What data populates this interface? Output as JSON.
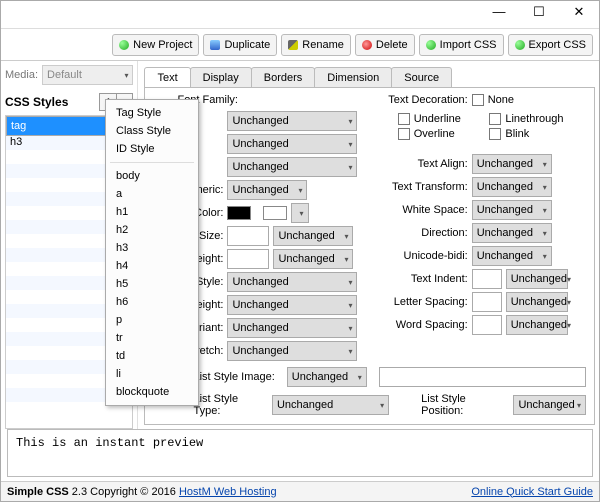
{
  "titlebar": {
    "min": "—",
    "max": "☐",
    "close": "✕"
  },
  "toolbar": {
    "new_project": "New Project",
    "duplicate": "Duplicate",
    "rename": "Rename",
    "delete": "Delete",
    "import_css": "Import CSS",
    "export_css": "Export CSS"
  },
  "media": {
    "label": "Media:",
    "value": "Default"
  },
  "css_styles_head": "CSS Styles",
  "plus": "+",
  "minus": "−",
  "styles": [
    "tag",
    "h3"
  ],
  "popup": {
    "tag": "Tag Style",
    "cls": "Class Style",
    "id": "ID Style",
    "tags": [
      "body",
      "a",
      "h1",
      "h2",
      "h3",
      "h4",
      "h5",
      "h6",
      "p",
      "tr",
      "td",
      "li",
      "blockquote"
    ]
  },
  "tabs": [
    "Text",
    "Display",
    "Borders",
    "Dimension",
    "Source"
  ],
  "active_tab": "Text",
  "fontfamily_label": "Font Family:",
  "unchanged": "Unchanged",
  "labels_left": {
    "generic": "Generic:",
    "color": "Color:",
    "size": "Font Size:",
    "weight": "Font Weight:",
    "style": "Font Style:",
    "height": "Line Height:",
    "variant": "Font Variant:",
    "stretch": "Font Stretch:"
  },
  "right_head": "Text Decoration:",
  "checks": {
    "none": "None",
    "underline": "Underline",
    "linethrough": "Linethrough",
    "overline": "Overline",
    "blink": "Blink"
  },
  "labels_right": {
    "align": "Text Align:",
    "transform": "Text Transform:",
    "whitespace": "White Space:",
    "direction": "Direction:",
    "unicode": "Unicode-bidi:",
    "indent": "Text Indent:",
    "letter": "Letter Spacing:",
    "word": "Word Spacing:"
  },
  "liststyle": {
    "img": "List Style Image:",
    "type": "List Style Type:",
    "pos": "List Style Position:"
  },
  "preview": "This is an instant preview",
  "status": {
    "app": "Simple CSS",
    "ver": " 2.3 Copyright © 2016 ",
    "link1": "HostM Web Hosting",
    "link2": "Online Quick Start Guide"
  }
}
